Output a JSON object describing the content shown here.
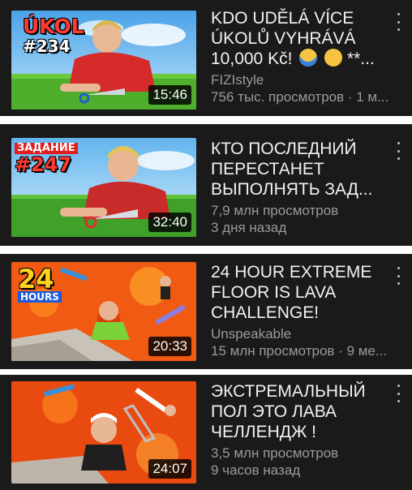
{
  "videos": [
    {
      "title": "KDO UDĚLÁ VÍCE ÚKOLŮ VYHRÁVÁ 10,000 Kč!",
      "title_tail": "**...",
      "thumb_badge_line1": "ÚKOL",
      "thumb_badge_line2": "#234",
      "channel": "FIZIstyle",
      "stats": "756 тыс. просмотров · 1 м...",
      "duration": "15:46"
    },
    {
      "title": "КТО ПОСЛЕДНИЙ ПЕРЕСТАНЕТ ВЫПОЛНЯТЬ ЗАД...",
      "thumb_badge_line1": "ЗАДАНИЕ",
      "thumb_badge_line2": "#247",
      "stats": "7,9 млн просмотров",
      "age": "3 дня назад",
      "duration": "32:40"
    },
    {
      "title": "24 HOUR EXTREME FLOOR IS LAVA CHALLENGE!",
      "thumb_badge_line1": "24",
      "thumb_badge_line2": "HOURS",
      "channel": "Unspeakable",
      "stats": "15 млн просмотров · 9 ме...",
      "duration": "20:33"
    },
    {
      "title": "ЭКСТРЕМАЛЬНЫЙ ПОЛ ЭТО ЛАВА ЧЕЛЛЕНДЖ !",
      "stats": "3,5 млн просмотров",
      "age": "9 часов назад",
      "duration": "24:07"
    }
  ],
  "colors": {
    "card_bg": "#1a1a1a",
    "title": "#f1f1f1",
    "meta": "#9a9a9a",
    "badge_red": "#e02020",
    "lava": "#f05a12"
  },
  "icons": [
    "more-vert-icon",
    "scream-emoji-icon",
    "worried-emoji-icon"
  ]
}
